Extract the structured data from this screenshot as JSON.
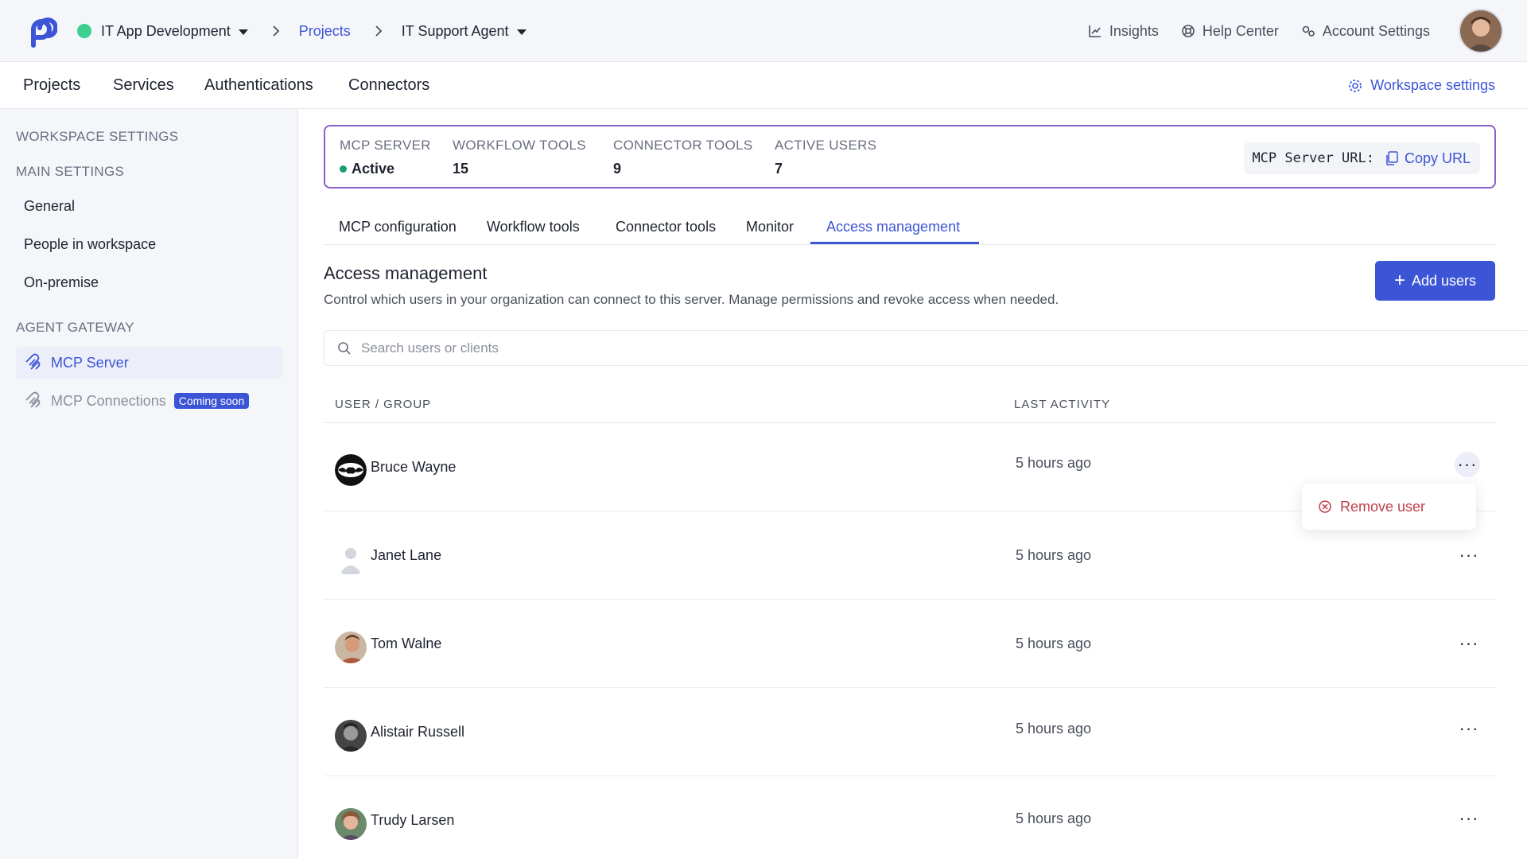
{
  "topbar": {
    "workspace": "IT App Development",
    "crumb_projects": "Projects",
    "project": "IT Support Agent",
    "insights": "Insights",
    "help_center": "Help Center",
    "account_settings": "Account Settings"
  },
  "mainnav": {
    "items": [
      "Projects",
      "Services",
      "Authentications",
      "Connectors"
    ],
    "workspace_settings": "Workspace settings"
  },
  "sidebar": {
    "heading_workspace": "WORKSPACE SETTINGS",
    "heading_main": "MAIN SETTINGS",
    "main_items": [
      "General",
      "People in workspace",
      "On-premise"
    ],
    "heading_gateway": "AGENT GATEWAY",
    "mcp_server": "MCP Server",
    "mcp_connections": "MCP Connections",
    "coming_soon": "Coming soon"
  },
  "stats": {
    "items": [
      {
        "label": "MCP SERVER",
        "value": "Active"
      },
      {
        "label": "WORKFLOW TOOLS",
        "value": "15"
      },
      {
        "label": "CONNECTOR TOOLS",
        "value": "9"
      },
      {
        "label": "ACTIVE USERS",
        "value": "7"
      }
    ],
    "url_label": "MCP Server URL:",
    "copy_url": "Copy URL",
    "status_color": "#1a9e6a"
  },
  "tabs": [
    "MCP configuration",
    "Workflow tools",
    "Connector tools",
    "Monitor",
    "Access management"
  ],
  "access": {
    "title": "Access management",
    "description": "Control which users in your organization can connect to this server. Manage permissions and revoke access when needed.",
    "add_users": "Add users",
    "search_placeholder": "Search users or clients"
  },
  "table": {
    "headers": [
      "USER / GROUP",
      "LAST ACTIVITY"
    ],
    "rows": [
      {
        "name": "Bruce Wayne",
        "activity": "5 hours ago"
      },
      {
        "name": "Janet Lane",
        "activity": "5 hours ago"
      },
      {
        "name": "Tom Walne",
        "activity": "5 hours ago"
      },
      {
        "name": "Alistair Russell",
        "activity": "5 hours ago"
      },
      {
        "name": "Trudy Larsen",
        "activity": "5 hours ago"
      }
    ]
  },
  "menu": {
    "remove_user": "Remove user"
  },
  "colors": {
    "accent": "#3c55d6",
    "danger": "#c0404a",
    "stats_border": "#8a5fc7"
  }
}
